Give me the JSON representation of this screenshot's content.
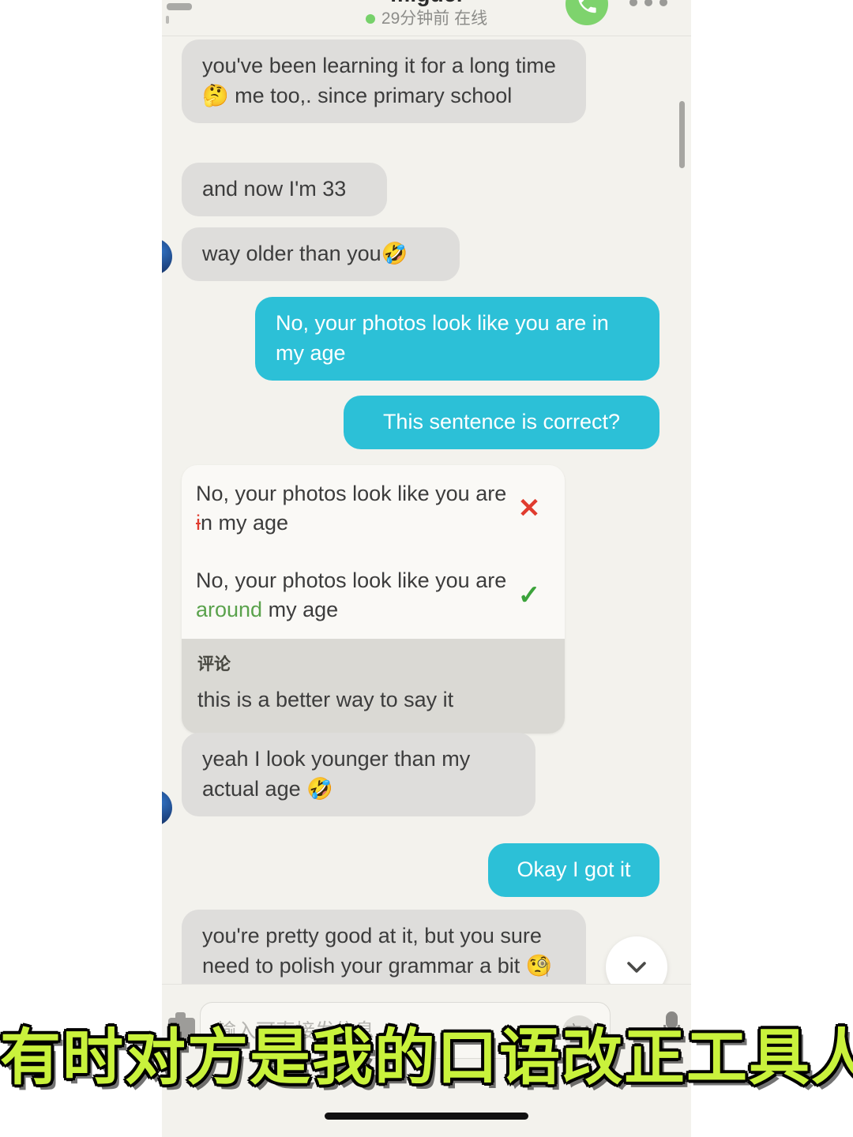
{
  "header": {
    "contact_name": "miguel",
    "presence": "29分钟前 在线",
    "online_dot_color": "#76d16a",
    "call_icon": "phone-icon",
    "more_icon": "more-options-icon",
    "back_icon": "back-arrow-icon"
  },
  "messages": [
    {
      "id": "m1",
      "side": "them",
      "text": "you've been learning it for a long time 🤔 me too,. since primary school"
    },
    {
      "id": "m2",
      "side": "them",
      "text": "and now I'm 33"
    },
    {
      "id": "m3",
      "side": "them",
      "text": "way older than you🤣"
    },
    {
      "id": "m4",
      "side": "me",
      "text": "No, your photos look like you are in my age"
    },
    {
      "id": "m5",
      "side": "me",
      "text": "This sentence is correct?"
    },
    {
      "id": "m6",
      "side": "them",
      "text": "yeah I look younger than my actual age 🤣"
    },
    {
      "id": "m7",
      "side": "me",
      "text": "Okay I got it"
    },
    {
      "id": "m8",
      "side": "them",
      "text": "you're pretty good at it, but you sure need to polish your grammar a bit 🧐 not that much"
    }
  ],
  "correction_card": {
    "wrong": {
      "prefix": "No, your photos look like you are ",
      "strike": "i",
      "suffix": "n my age",
      "mark": "✕",
      "mark_color": "#e03c2f"
    },
    "right": {
      "prefix": "No, your photos look like you are ",
      "insert": "around",
      "suffix": " my age",
      "mark": "✓",
      "mark_color": "#3ba33b"
    },
    "comment_label": "评论",
    "comment_text": "this is a better way to say it"
  },
  "input_bar": {
    "placeholder": "输入可直接发信息",
    "translate_label": "文A",
    "attach_icon": "camera-icon",
    "mic_icon": "microphone-icon"
  },
  "scroll_down": {
    "icon": "chevron-down-icon"
  },
  "caption": {
    "text": "有时对方是我的口语改正工具人",
    "fill_color": "#c9f23c",
    "outline_color": "#000000"
  },
  "theme": {
    "chat_background": "#f3f2ed",
    "outgoing_bubble": "#2cc0d7",
    "incoming_bubble": "#dedddb",
    "card_background": "#faf9f6",
    "comment_background": "#dad9d4"
  }
}
